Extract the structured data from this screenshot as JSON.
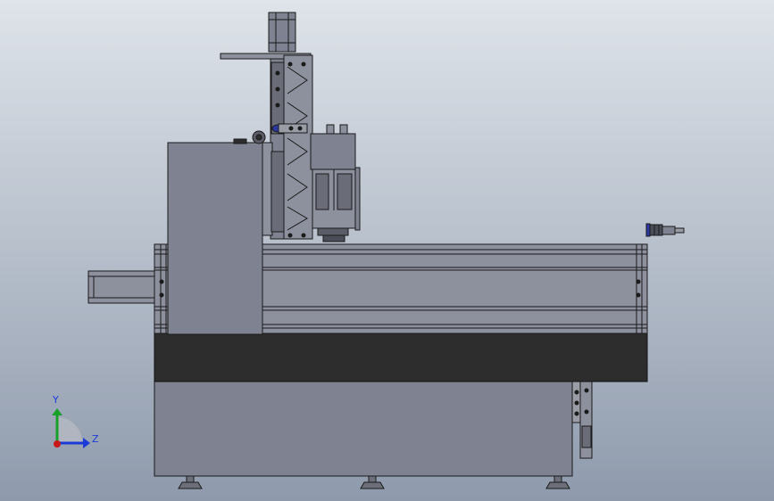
{
  "view": {
    "background_top": "#dfe4ea",
    "background_bottom": "#8e9aac"
  },
  "colors": {
    "metal": "#7f8290",
    "metal_light": "#8d909d",
    "metal_dark": "#5f626d",
    "edge": "#1a1a1a",
    "base_band": "#2d2d2d",
    "triad_y": "#18a028",
    "triad_z": "#1a3bd8",
    "triad_x": "#c81818"
  },
  "triad": {
    "y_label": "Y",
    "z_label": "Z",
    "label_color": "#1a3bd8"
  }
}
